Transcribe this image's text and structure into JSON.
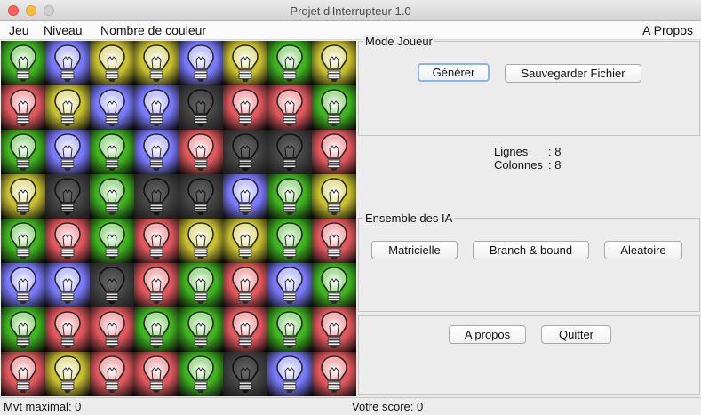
{
  "window": {
    "title": "Projet d'Interrupteur 1.0"
  },
  "menu": {
    "jeu": "Jeu",
    "niveau": "Niveau",
    "nombre_couleur": "Nombre de couleur",
    "a_propos": "A Propos"
  },
  "colors": {
    "G": "#3fb51f",
    "B": "#7b7bff",
    "Y": "#c8c030",
    "R": "#e2585d",
    "K": "#4a4a4a"
  },
  "grid": {
    "rows": [
      [
        "G",
        "B",
        "Y",
        "Y",
        "B",
        "Y",
        "G",
        "Y"
      ],
      [
        "R",
        "Y",
        "B",
        "B",
        "K",
        "R",
        "R",
        "G"
      ],
      [
        "G",
        "B",
        "G",
        "B",
        "R",
        "K",
        "K",
        "R"
      ],
      [
        "Y",
        "K",
        "G",
        "K",
        "K",
        "B",
        "G",
        "Y"
      ],
      [
        "G",
        "R",
        "G",
        "R",
        "Y",
        "Y",
        "G",
        "R"
      ],
      [
        "B",
        "B",
        "K",
        "R",
        "G",
        "R",
        "B",
        "G"
      ],
      [
        "G",
        "R",
        "R",
        "G",
        "G",
        "R",
        "G",
        "R"
      ],
      [
        "R",
        "Y",
        "R",
        "R",
        "G",
        "K",
        "B",
        "R"
      ]
    ]
  },
  "mode_joueur": {
    "legend": "Mode Joueur",
    "generer": "Générer",
    "sauvegarder": "Sauvegarder Fichier"
  },
  "dimensions": {
    "lignes_label": "Lignes",
    "lignes_value": ": 8",
    "colonnes_label": "Colonnes",
    "colonnes_value": ": 8"
  },
  "ia": {
    "legend": "Ensemble des IA",
    "matricielle": "Matricielle",
    "branch_bound": "Branch & bound",
    "aleatoire": "Aleatoire"
  },
  "bottom": {
    "a_propos": "A propos",
    "quitter": "Quitter"
  },
  "status": {
    "mvt_maximal": "Mvt maximal: 0",
    "score": "Votre score: 0"
  }
}
